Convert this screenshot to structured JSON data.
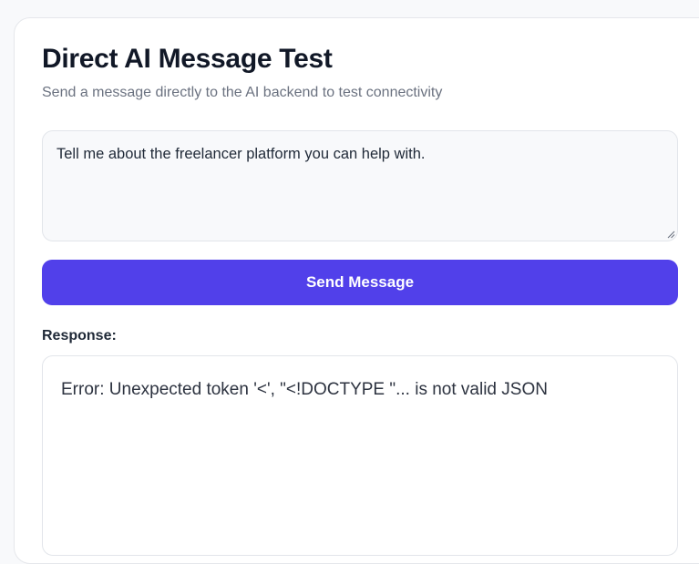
{
  "header": {
    "title": "Direct AI Message Test",
    "subtitle": "Send a message directly to the AI backend to test connectivity"
  },
  "message": {
    "value": "Tell me about the freelancer platform you can help with."
  },
  "send_button": {
    "label": "Send Message"
  },
  "response": {
    "label": "Response:",
    "text": "Error: Unexpected token '<', \"<!DOCTYPE \"... is not valid JSON"
  },
  "colors": {
    "accent": "#5140ea",
    "title_text": "#111827",
    "subtitle_text": "#6b7280",
    "page_background": "#f8f9fb",
    "border": "#e2e5ea"
  }
}
